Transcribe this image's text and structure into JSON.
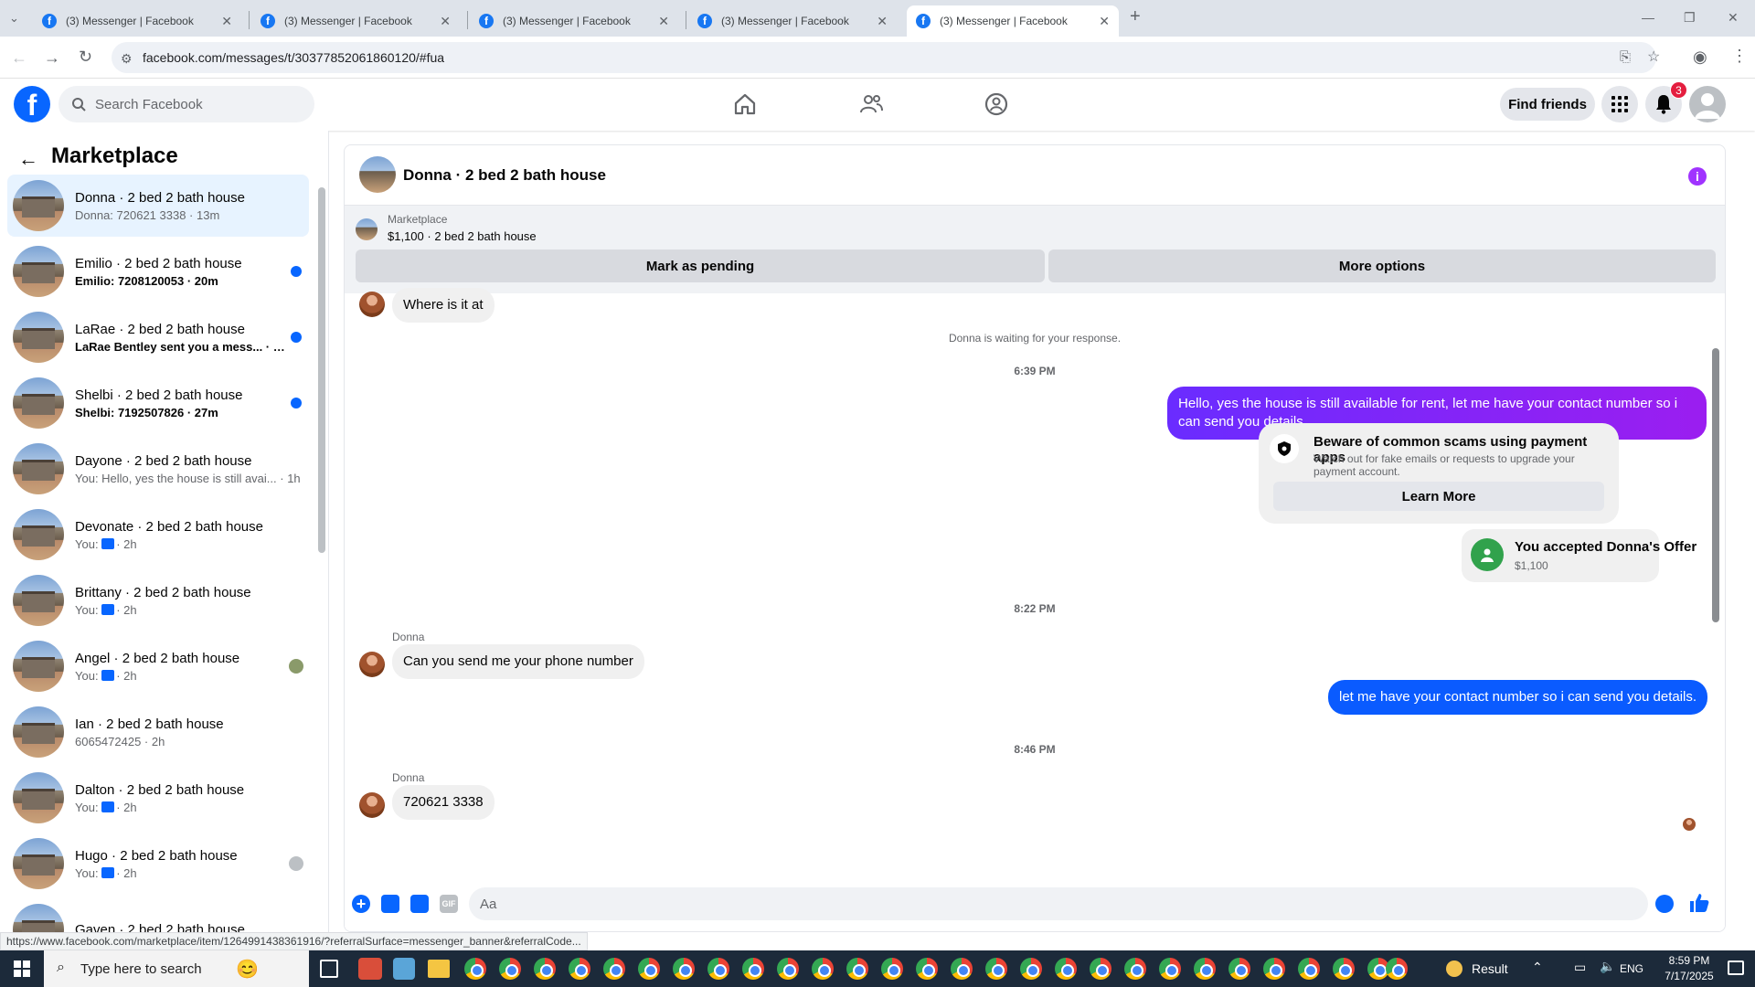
{
  "browser": {
    "tabs": [
      {
        "title": "(3) Messenger | Facebook",
        "active": false
      },
      {
        "title": "(3) Messenger | Facebook",
        "active": false
      },
      {
        "title": "(3) Messenger | Facebook",
        "active": false
      },
      {
        "title": "(3) Messenger | Facebook",
        "active": false
      },
      {
        "title": "(3) Messenger | Facebook",
        "active": true
      }
    ],
    "url": "facebook.com/messages/t/30377852061860120/#fua",
    "status_url": "https://www.facebook.com/marketplace/item/1264991438361916/?referralSurface=messenger_banner&referralCode..."
  },
  "header": {
    "search_placeholder": "Search Facebook",
    "find_friends": "Find friends",
    "notification_count": "3"
  },
  "sidebar": {
    "title": "Marketplace",
    "conversations": [
      {
        "name": "Donna · 2 bed 2 bath house",
        "preview": "Donna: 720621 3338 · 13m",
        "unread": false,
        "selected": true
      },
      {
        "name": "Emilio · 2 bed 2 bath house",
        "preview": "Emilio: 7208120053 · 20m",
        "unread": true
      },
      {
        "name": "LaRae · 2 bed 2 bath house",
        "preview": "LaRae Bentley sent you a mess... · 26m",
        "unread": true
      },
      {
        "name": "Shelbi · 2 bed 2 bath house",
        "preview": "Shelbi: 7192507826 · 27m",
        "unread": true
      },
      {
        "name": "Dayone · 2 bed 2 bath house",
        "preview": "You: Hello, yes the house is still avai... · 1h",
        "unread": false
      },
      {
        "name": "Devonate · 2 bed 2 bath house",
        "preview_prefix": "You:",
        "preview_suffix": "· 2h",
        "unread": false
      },
      {
        "name": "Brittany · 2 bed 2 bath house",
        "preview_prefix": "You:",
        "preview_suffix": "· 2h",
        "unread": false
      },
      {
        "name": "Angel · 2 bed 2 bath house",
        "preview_prefix": "You:",
        "preview_suffix": "· 2h",
        "unread": false
      },
      {
        "name": "Ian · 2 bed 2 bath house",
        "preview": "6065472425 · 2h",
        "unread": false
      },
      {
        "name": "Dalton · 2 bed 2 bath house",
        "preview_prefix": "You:",
        "preview_suffix": "· 2h",
        "unread": false
      },
      {
        "name": "Hugo · 2 bed 2 bath house",
        "preview_prefix": "You:",
        "preview_suffix": "· 2h",
        "unread": false
      },
      {
        "name": "Gaven · 2 bed 2 bath house",
        "preview": "",
        "unread": false
      }
    ]
  },
  "chat": {
    "title": "Donna · 2 bed 2 bath house",
    "marketplace_label": "Marketplace",
    "listing": "$1,100 · 2 bed 2 bath house",
    "mark_pending": "Mark as pending",
    "more_options": "More options",
    "messages": {
      "m1": "Where is it at",
      "waiting": "Donna is waiting for your response.",
      "time1": "6:39 PM",
      "m2": "Hello, yes the house is still available for rent, let me have your contact number so i can send you details.",
      "scam_title": "Beware of common scams using payment apps",
      "scam_body": "Watch out for fake emails or requests to upgrade your payment account.",
      "learn_more": "Learn More",
      "offer_title": "You accepted Donna's Offer",
      "offer_price": "$1,100",
      "time2": "8:22 PM",
      "sender": "Donna",
      "m3": "Can you send me your phone number",
      "m4": "let me have your contact number so i can send you details.",
      "time3": "8:46 PM",
      "m5": "720621 3338"
    },
    "composer_placeholder": "Aa"
  },
  "taskbar": {
    "search_placeholder": "Type here to search",
    "result_label": "Result",
    "lang": "ENG",
    "time": "8:59 PM",
    "date": "7/17/2025"
  }
}
